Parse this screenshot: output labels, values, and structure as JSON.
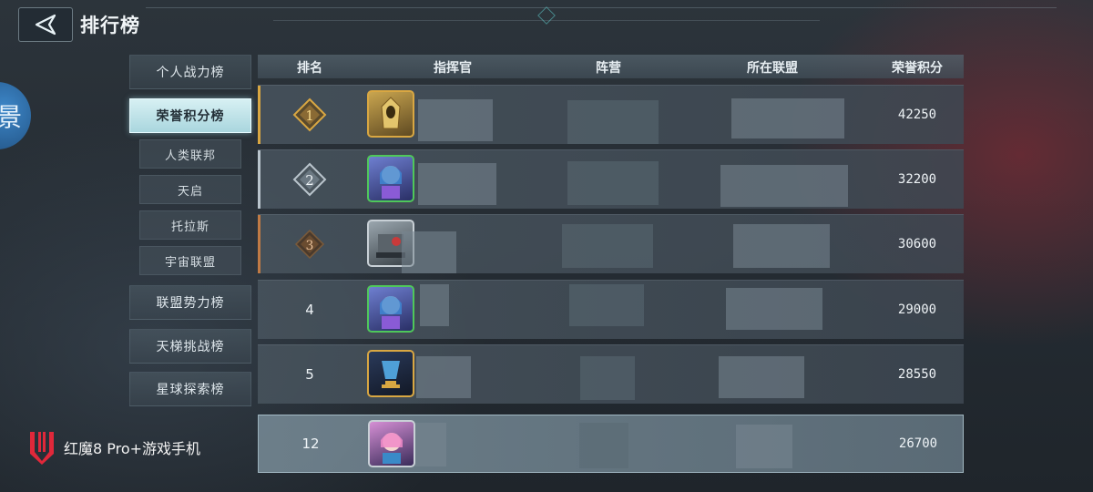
{
  "header": {
    "title": "排行榜",
    "back_icon": "back-arrow-icon"
  },
  "side_orb_glyph": "景",
  "menu": {
    "items": [
      {
        "label": "个人战力榜",
        "active": false
      },
      {
        "label": "荣誉积分榜",
        "active": true
      },
      {
        "label": "联盟势力榜",
        "active": false
      },
      {
        "label": "天梯挑战榜",
        "active": false
      },
      {
        "label": "星球探索榜",
        "active": false
      }
    ],
    "sub_items": [
      {
        "label": "人类联邦"
      },
      {
        "label": "天启"
      },
      {
        "label": "托拉斯"
      },
      {
        "label": "宇宙联盟"
      }
    ]
  },
  "table": {
    "columns": [
      "排名",
      "指挥官",
      "阵营",
      "所在联盟",
      "荣誉积分"
    ],
    "rows": [
      {
        "rank": "1",
        "badge": "gold",
        "honor": "42250",
        "avatar": "gold-helmet-avatar"
      },
      {
        "rank": "2",
        "badge": "silver",
        "honor": "32200",
        "avatar": "blue-hair-girl-avatar"
      },
      {
        "rank": "3",
        "badge": "bronze",
        "honor": "30600",
        "avatar": "mech-avatar"
      },
      {
        "rank": "4",
        "badge": "none",
        "honor": "29000",
        "avatar": "blue-hair-girl-avatar"
      },
      {
        "rank": "5",
        "badge": "none",
        "honor": "28550",
        "avatar": "trophy-emblem-avatar"
      },
      {
        "rank": "12",
        "badge": "none",
        "honor": "26700",
        "avatar": "pink-hair-girl-avatar",
        "self": true
      }
    ]
  },
  "watermark": {
    "text": "红魔8 Pro+游戏手机"
  },
  "colors": {
    "gold": "#d9a742",
    "silver": "#b9c4cc",
    "bronze": "#c07a45",
    "active_menu": "#bfe5eb",
    "watermark_red": "#e0283a"
  }
}
